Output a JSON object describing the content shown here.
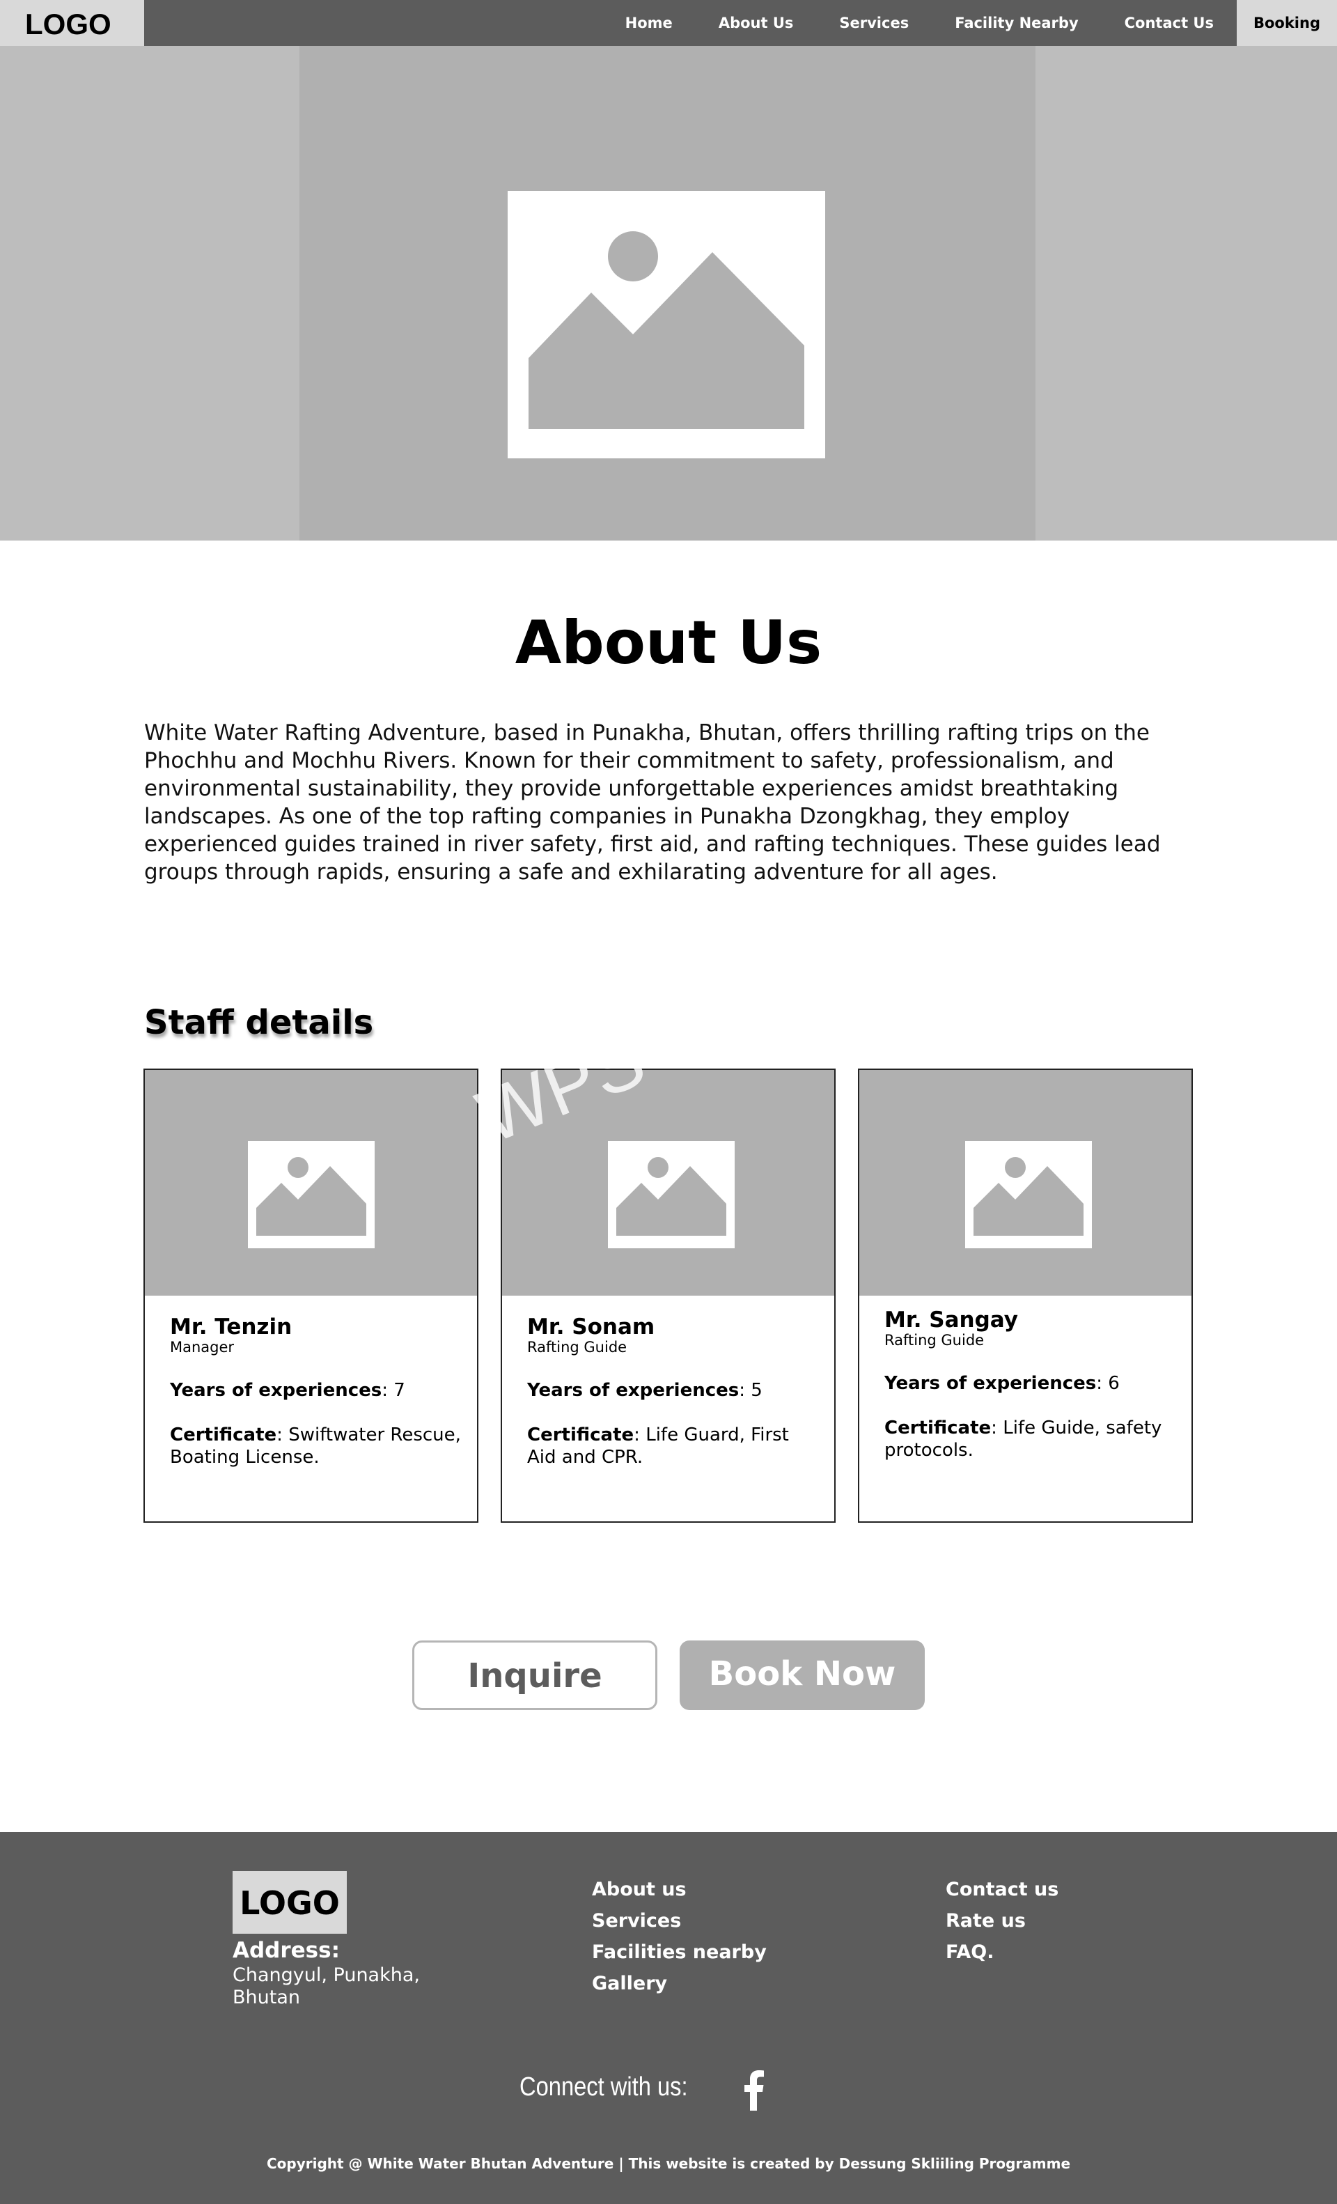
{
  "nav": {
    "logo": "LOGO",
    "links": [
      "Home",
      "About Us",
      "Services",
      "Facility Nearby",
      "Contact Us"
    ],
    "booking": "Booking"
  },
  "hero": {
    "image_icon": "image-placeholder-icon"
  },
  "about": {
    "title": "About Us",
    "text": "White Water Rafting Adventure, based in Punakha, Bhutan, offers thrilling rafting trips on the Phochhu and Mochhu Rivers. Known for their commitment to safety, professionalism, and environmental sustainability, they provide unforgettable experiences amidst breathtaking landscapes. As one of the top rafting companies in Punakha Dzongkhag, they employ experienced guides trained in river safety, first aid, and rafting techniques. These guides lead groups through rapids, ensuring a safe and exhilarating adventure for all ages."
  },
  "staff": {
    "title": "Staff details",
    "years_label": "Years of experiences",
    "cert_label": "Certificate",
    "members": [
      {
        "name": "Mr. Tenzin",
        "role": "Manager",
        "years": "7",
        "certificate": "Swiftwater Rescue, Boating License."
      },
      {
        "name": "Mr. Sonam",
        "role": "Rafting Guide",
        "years": "5",
        "certificate": "Life Guard, First Aid and CPR."
      },
      {
        "name": "Mr. Sangay",
        "role": "Rafting Guide",
        "years": "6",
        "certificate": "Life Guide, safety protocols."
      }
    ]
  },
  "actions": {
    "inquire": "Inquire",
    "book": "Book Now"
  },
  "watermark": "WPS Office",
  "footer": {
    "logo": "LOGO",
    "address_label": "Address:",
    "address": "Changyul, Punakha, Bhutan",
    "col1": [
      "About us",
      "Services",
      "Facilities nearby",
      "Gallery"
    ],
    "col2": [
      "Contact us",
      "Rate us",
      "FAQ."
    ],
    "connect": "Connect with us:",
    "social_icon": "facebook-icon",
    "copyright": "Copyright @ White Water Bhutan Adventure | This website is created by Dessung Skliiling Programme"
  },
  "colors": {
    "nav_bg": "#5c5c5c",
    "logo_bg": "#d9d9d9",
    "placeholder": "#b0b0b0",
    "footer_bg": "#5c5c5c"
  }
}
